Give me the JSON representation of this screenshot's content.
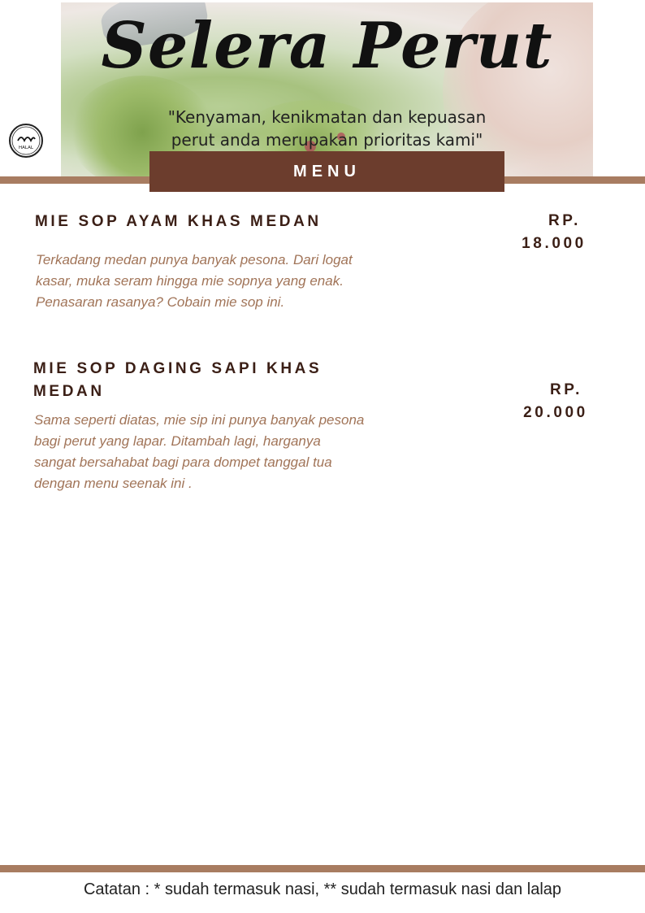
{
  "header": {
    "logo_text": "Selera Perut",
    "tagline_line1": "\"Kenyaman, kenikmatan dan kepuasan",
    "tagline_line2": "perut anda merupakan prioritas kami\"",
    "menu_label": "MENU",
    "halal_label": "HALAL"
  },
  "items": [
    {
      "title": "MIE SOP AYAM KHAS MEDAN",
      "desc_lines": [
        "Terkadang medan punya banyak pesona. Dari logat",
        "kasar, muka seram hingga mie sopnya yang enak.",
        "Penasaran rasanya? Cobain mie sop ini."
      ],
      "price_line1": "RP.",
      "price_line2": "18.000"
    },
    {
      "title_line1": "MIE SOP DAGING SAPI KHAS",
      "title_line2": "MEDAN",
      "desc_lines": [
        "Sama seperti diatas, mie sip ini punya banyak pesona",
        "bagi  perut yang lapar. Ditambah lagi, harganya",
        "sangat bersahabat bagi para dompet tanggal tua",
        "dengan menu seenak ini ."
      ],
      "price_line1": "RP.",
      "price_line2": "20.000"
    }
  ],
  "footer": {
    "note": "Catatan : * sudah termasuk nasi, ** sudah termasuk nasi dan lalap"
  },
  "colors": {
    "band": "#a87c61",
    "banner": "#6c3d2d",
    "title_text": "#3b1f16",
    "desc_text": "#a17458"
  }
}
